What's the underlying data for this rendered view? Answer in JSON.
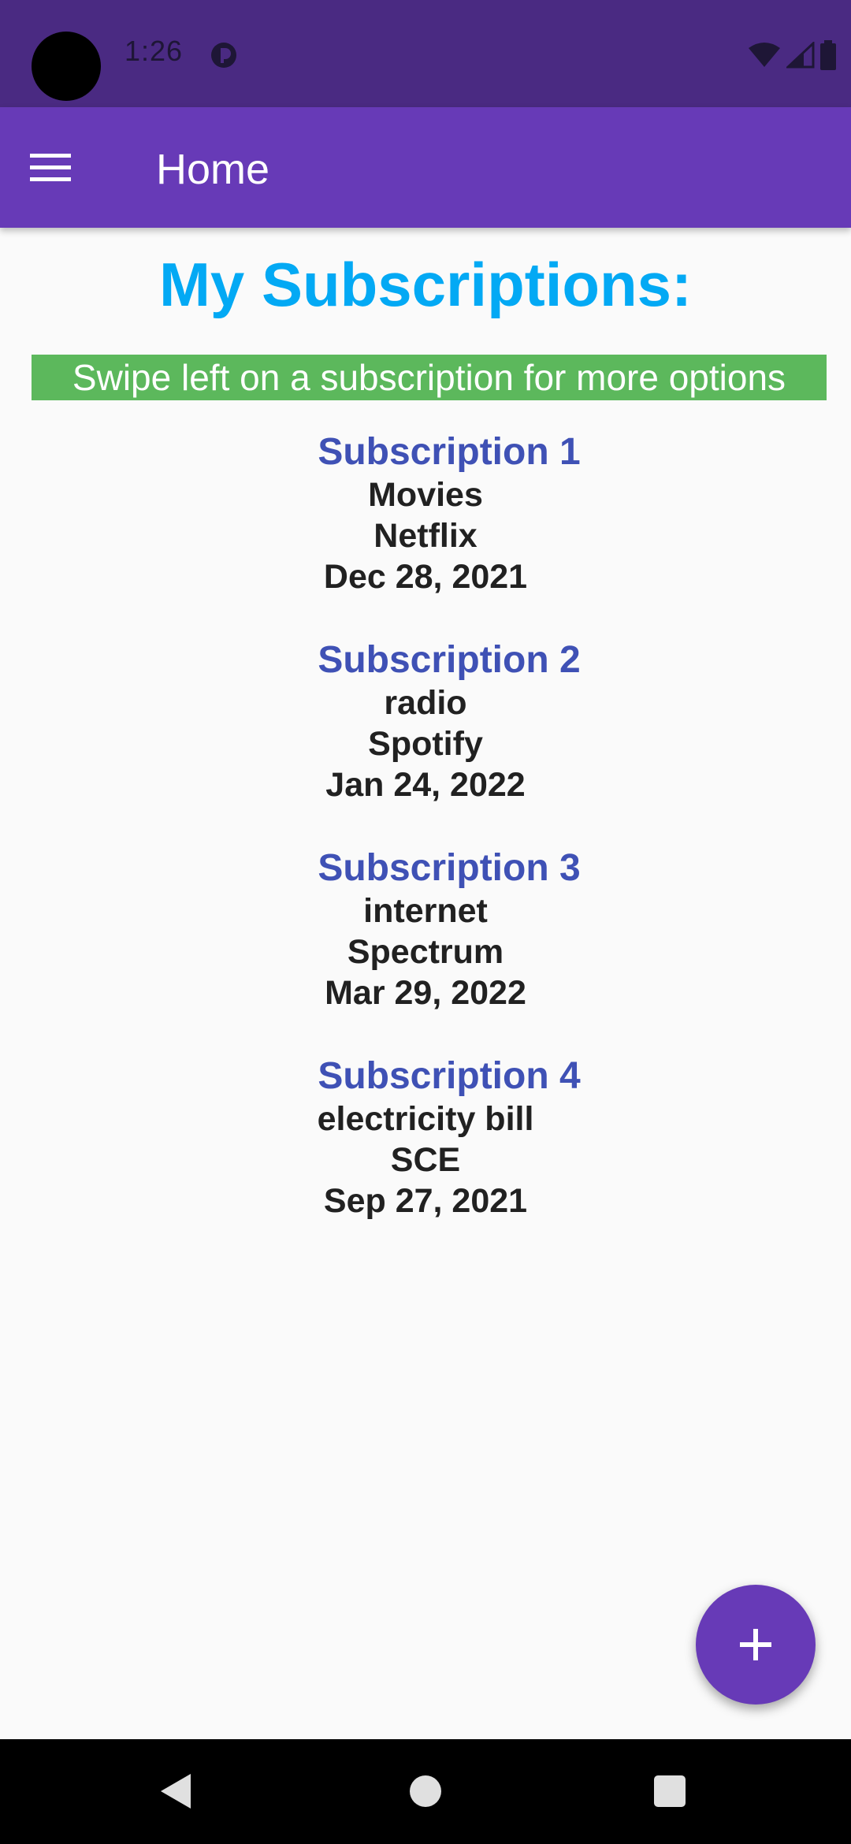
{
  "status_bar": {
    "time": "1:26",
    "icons": [
      "app-notification-icon",
      "wifi-icon",
      "signal-icon",
      "battery-icon"
    ]
  },
  "app_bar": {
    "title": "Home",
    "menu_icon": "hamburger-menu-icon"
  },
  "main": {
    "heading": "My Subscriptions:",
    "hint": "Swipe left on a subscription for more options",
    "subscriptions": [
      {
        "title": "Subscription 1",
        "category": "Movies",
        "provider": "Netflix",
        "date": "Dec 28, 2021"
      },
      {
        "title": "Subscription 2",
        "category": "radio",
        "provider": "Spotify",
        "date": "Jan 24, 2022"
      },
      {
        "title": "Subscription 3",
        "category": "internet",
        "provider": "Spectrum",
        "date": "Mar 29, 2022"
      },
      {
        "title": "Subscription 4",
        "category": "electricity bill",
        "provider": "SCE",
        "date": "Sep 27, 2021"
      }
    ]
  },
  "fab": {
    "icon": "plus-icon"
  },
  "nav_bar": {
    "icons": [
      "back-icon",
      "home-icon",
      "recents-icon"
    ]
  },
  "colors": {
    "status_bar": "#4a2a82",
    "app_bar": "#673ab7",
    "heading": "#03a9f4",
    "hint_background": "#5cb85c",
    "subscription_title": "#3f51b5",
    "fab": "#673ab7"
  }
}
